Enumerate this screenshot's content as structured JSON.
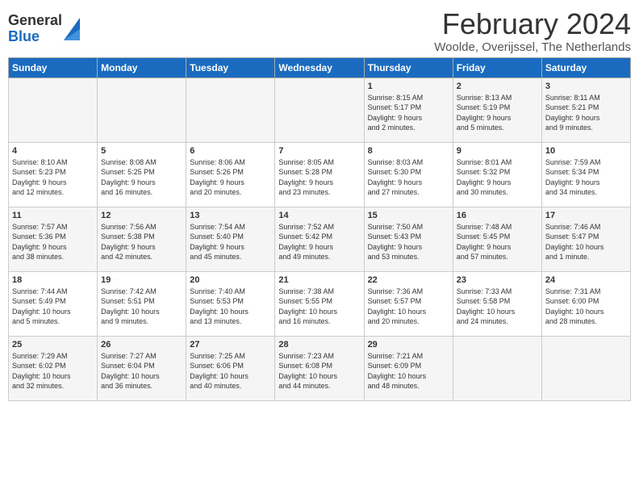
{
  "logo": {
    "general": "General",
    "blue": "Blue"
  },
  "header": {
    "month_year": "February 2024",
    "location": "Woolde, Overijssel, The Netherlands"
  },
  "weekdays": [
    "Sunday",
    "Monday",
    "Tuesday",
    "Wednesday",
    "Thursday",
    "Friday",
    "Saturday"
  ],
  "weeks": [
    [
      {
        "day": "",
        "content": ""
      },
      {
        "day": "",
        "content": ""
      },
      {
        "day": "",
        "content": ""
      },
      {
        "day": "",
        "content": ""
      },
      {
        "day": "1",
        "content": "Sunrise: 8:15 AM\nSunset: 5:17 PM\nDaylight: 9 hours\nand 2 minutes."
      },
      {
        "day": "2",
        "content": "Sunrise: 8:13 AM\nSunset: 5:19 PM\nDaylight: 9 hours\nand 5 minutes."
      },
      {
        "day": "3",
        "content": "Sunrise: 8:11 AM\nSunset: 5:21 PM\nDaylight: 9 hours\nand 9 minutes."
      }
    ],
    [
      {
        "day": "4",
        "content": "Sunrise: 8:10 AM\nSunset: 5:23 PM\nDaylight: 9 hours\nand 12 minutes."
      },
      {
        "day": "5",
        "content": "Sunrise: 8:08 AM\nSunset: 5:25 PM\nDaylight: 9 hours\nand 16 minutes."
      },
      {
        "day": "6",
        "content": "Sunrise: 8:06 AM\nSunset: 5:26 PM\nDaylight: 9 hours\nand 20 minutes."
      },
      {
        "day": "7",
        "content": "Sunrise: 8:05 AM\nSunset: 5:28 PM\nDaylight: 9 hours\nand 23 minutes."
      },
      {
        "day": "8",
        "content": "Sunrise: 8:03 AM\nSunset: 5:30 PM\nDaylight: 9 hours\nand 27 minutes."
      },
      {
        "day": "9",
        "content": "Sunrise: 8:01 AM\nSunset: 5:32 PM\nDaylight: 9 hours\nand 30 minutes."
      },
      {
        "day": "10",
        "content": "Sunrise: 7:59 AM\nSunset: 5:34 PM\nDaylight: 9 hours\nand 34 minutes."
      }
    ],
    [
      {
        "day": "11",
        "content": "Sunrise: 7:57 AM\nSunset: 5:36 PM\nDaylight: 9 hours\nand 38 minutes."
      },
      {
        "day": "12",
        "content": "Sunrise: 7:56 AM\nSunset: 5:38 PM\nDaylight: 9 hours\nand 42 minutes."
      },
      {
        "day": "13",
        "content": "Sunrise: 7:54 AM\nSunset: 5:40 PM\nDaylight: 9 hours\nand 45 minutes."
      },
      {
        "day": "14",
        "content": "Sunrise: 7:52 AM\nSunset: 5:42 PM\nDaylight: 9 hours\nand 49 minutes."
      },
      {
        "day": "15",
        "content": "Sunrise: 7:50 AM\nSunset: 5:43 PM\nDaylight: 9 hours\nand 53 minutes."
      },
      {
        "day": "16",
        "content": "Sunrise: 7:48 AM\nSunset: 5:45 PM\nDaylight: 9 hours\nand 57 minutes."
      },
      {
        "day": "17",
        "content": "Sunrise: 7:46 AM\nSunset: 5:47 PM\nDaylight: 10 hours\nand 1 minute."
      }
    ],
    [
      {
        "day": "18",
        "content": "Sunrise: 7:44 AM\nSunset: 5:49 PM\nDaylight: 10 hours\nand 5 minutes."
      },
      {
        "day": "19",
        "content": "Sunrise: 7:42 AM\nSunset: 5:51 PM\nDaylight: 10 hours\nand 9 minutes."
      },
      {
        "day": "20",
        "content": "Sunrise: 7:40 AM\nSunset: 5:53 PM\nDaylight: 10 hours\nand 13 minutes."
      },
      {
        "day": "21",
        "content": "Sunrise: 7:38 AM\nSunset: 5:55 PM\nDaylight: 10 hours\nand 16 minutes."
      },
      {
        "day": "22",
        "content": "Sunrise: 7:36 AM\nSunset: 5:57 PM\nDaylight: 10 hours\nand 20 minutes."
      },
      {
        "day": "23",
        "content": "Sunrise: 7:33 AM\nSunset: 5:58 PM\nDaylight: 10 hours\nand 24 minutes."
      },
      {
        "day": "24",
        "content": "Sunrise: 7:31 AM\nSunset: 6:00 PM\nDaylight: 10 hours\nand 28 minutes."
      }
    ],
    [
      {
        "day": "25",
        "content": "Sunrise: 7:29 AM\nSunset: 6:02 PM\nDaylight: 10 hours\nand 32 minutes."
      },
      {
        "day": "26",
        "content": "Sunrise: 7:27 AM\nSunset: 6:04 PM\nDaylight: 10 hours\nand 36 minutes."
      },
      {
        "day": "27",
        "content": "Sunrise: 7:25 AM\nSunset: 6:06 PM\nDaylight: 10 hours\nand 40 minutes."
      },
      {
        "day": "28",
        "content": "Sunrise: 7:23 AM\nSunset: 6:08 PM\nDaylight: 10 hours\nand 44 minutes."
      },
      {
        "day": "29",
        "content": "Sunrise: 7:21 AM\nSunset: 6:09 PM\nDaylight: 10 hours\nand 48 minutes."
      },
      {
        "day": "",
        "content": ""
      },
      {
        "day": "",
        "content": ""
      }
    ]
  ]
}
